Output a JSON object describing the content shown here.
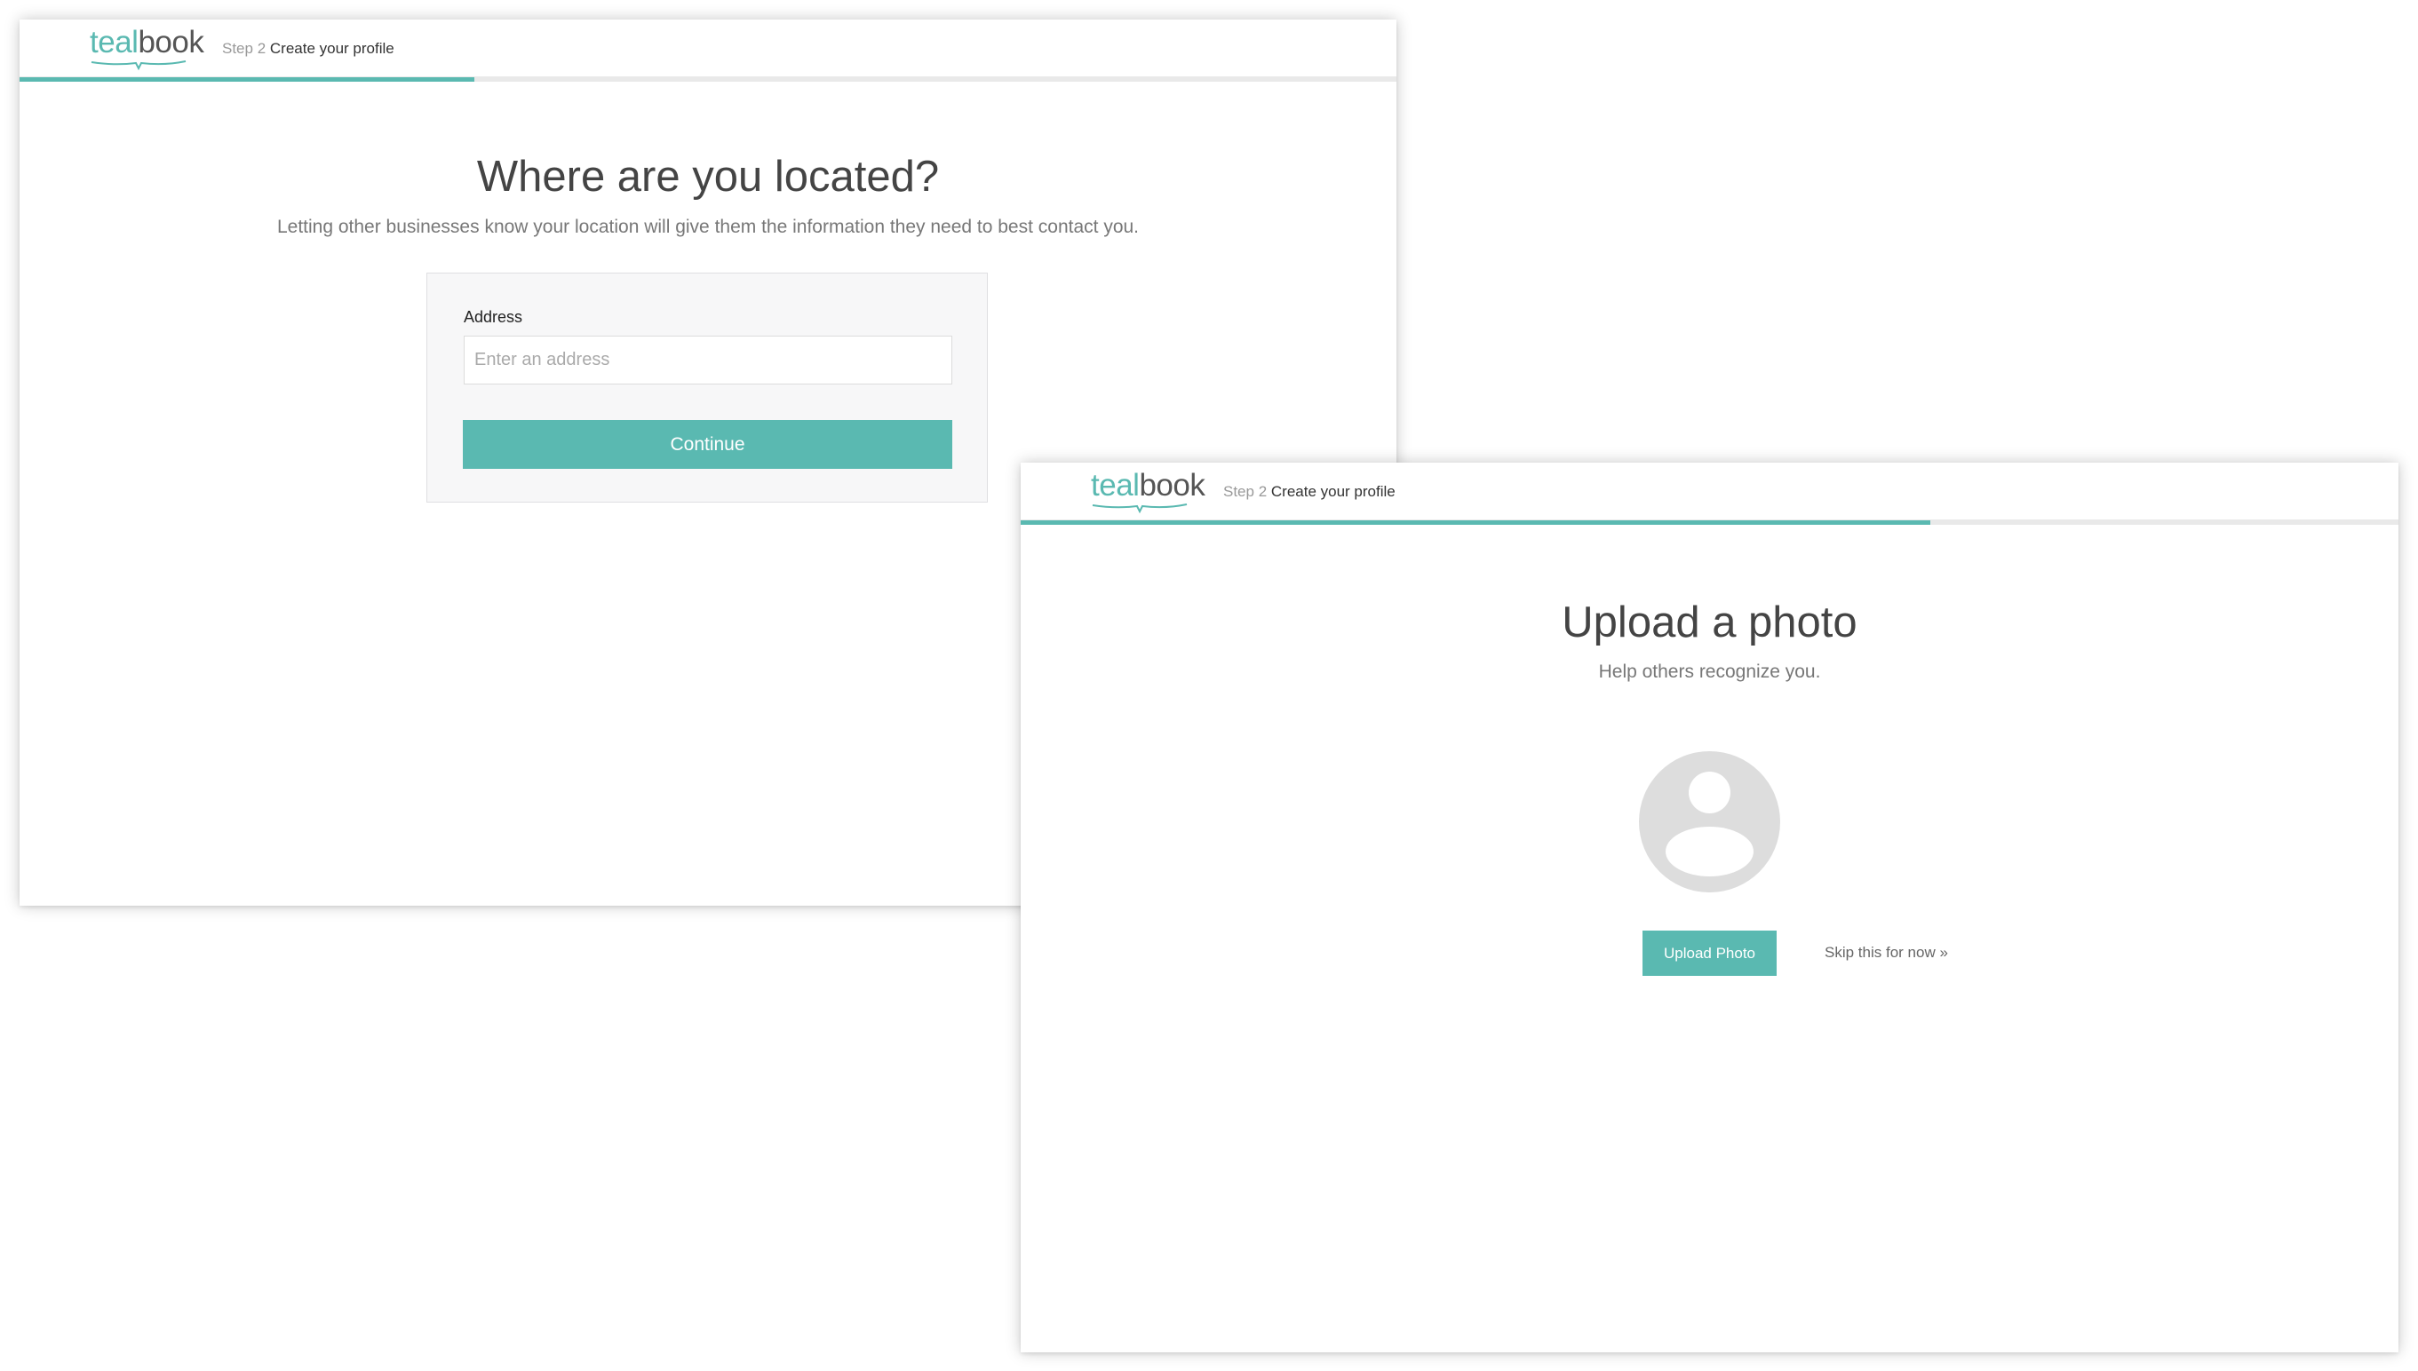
{
  "location_panel": {
    "logo": {
      "part1": "teal",
      "part2": "book"
    },
    "step_number": "Step 2",
    "step_title": "Create your profile",
    "progress_fraction": 0.33,
    "heading": "Where are you located?",
    "subheading": "Letting other businesses know your location will give them the information they need to best contact you.",
    "address_label": "Address",
    "address_placeholder": "Enter an address",
    "address_value": "",
    "continue_label": "Continue"
  },
  "photo_panel": {
    "logo": {
      "part1": "teal",
      "part2": "book"
    },
    "step_number": "Step 2",
    "step_title": "Create your profile",
    "progress_fraction": 0.66,
    "heading": "Upload a photo",
    "subheading": "Help others recognize you.",
    "avatar_icon": "user-placeholder-icon",
    "upload_label": "Upload Photo",
    "skip_label": "Skip this for now »"
  },
  "colors": {
    "accent": "#5ab9b1",
    "heading": "#444444",
    "muted": "#777777",
    "avatar_bg": "#dddddd"
  }
}
